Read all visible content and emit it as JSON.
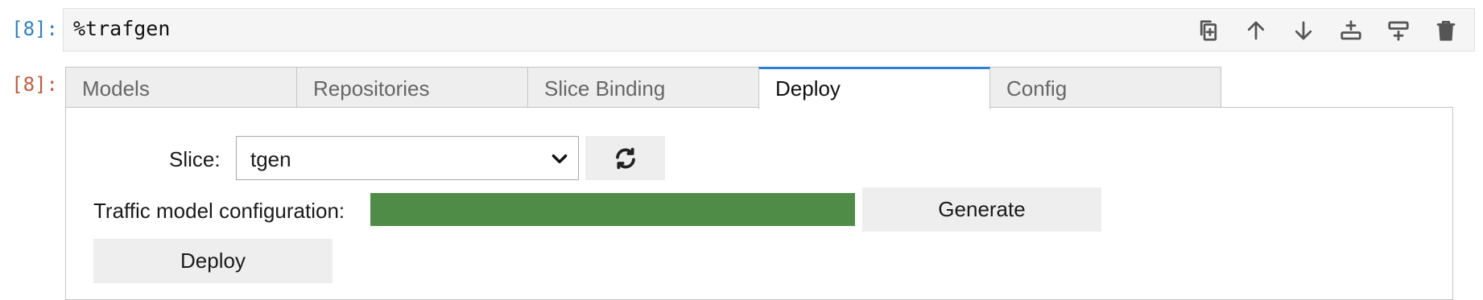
{
  "input_cell": {
    "prompt": "[8]:",
    "code": "%trafgen",
    "toolbar_icons": [
      "duplicate-icon",
      "arrow-up-icon",
      "arrow-down-icon",
      "insert-above-icon",
      "insert-below-icon",
      "trash-icon"
    ]
  },
  "output_cell": {
    "prompt": "[8]:"
  },
  "tabs": [
    {
      "label": "Models",
      "active": false
    },
    {
      "label": "Repositories",
      "active": false
    },
    {
      "label": "Slice Binding",
      "active": false
    },
    {
      "label": "Deploy",
      "active": true
    },
    {
      "label": "Config",
      "active": false
    }
  ],
  "deploy": {
    "slice_label": "Slice:",
    "slice_value": "tgen",
    "refresh_icon": "refresh-icon",
    "traffic_label": "Traffic model configuration:",
    "traffic_progress": 1.0,
    "generate_label": "Generate",
    "deploy_label": "Deploy"
  },
  "colors": {
    "accent": "#2f7ed8",
    "progress": "#4f8c47",
    "in_prompt": "#307fc1",
    "out_prompt": "#bf5b3d"
  }
}
